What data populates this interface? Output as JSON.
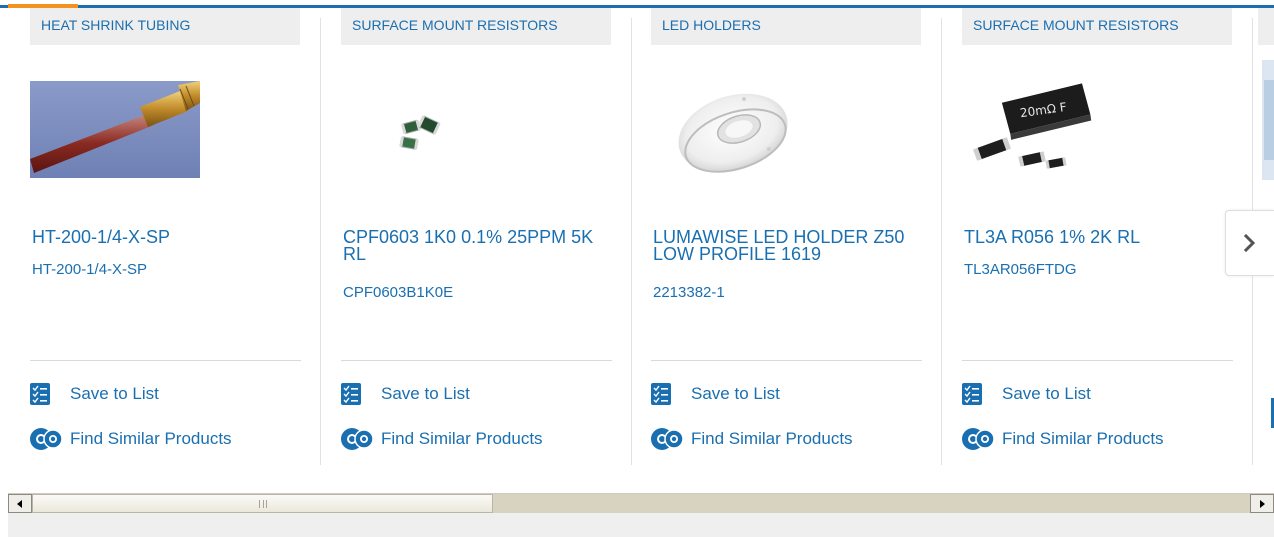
{
  "products": [
    {
      "category": "HEAT SHRINK TUBING",
      "title": "HT-200-1/4-X-SP",
      "part_number": "HT-200-1/4-X-SP",
      "image": "heat-shrink-tubing-photo",
      "save_label": "Save to List",
      "similar_label": "Find Similar Products"
    },
    {
      "category": "SURFACE MOUNT RESISTORS",
      "title": "CPF0603 1K0 0.1% 25PPM 5K RL",
      "part_number": "CPF0603B1K0E",
      "image": "smd-resistor-chips-photo",
      "save_label": "Save to List",
      "similar_label": "Find Similar Products"
    },
    {
      "category": "LED HOLDERS",
      "title": "LUMAWISE LED HOLDER Z50 LOW PROFILE 1619",
      "part_number": "2213382-1",
      "image": "led-holder-ring-photo",
      "save_label": "Save to List",
      "similar_label": "Find Similar Products"
    },
    {
      "category": "SURFACE MOUNT RESISTORS",
      "title": "TL3A R056 1% 2K RL",
      "part_number": "TL3AR056FTDG",
      "image": "current-sense-resistor-photo",
      "image_text": "20mΩ F",
      "save_label": "Save to List",
      "similar_label": "Find Similar Products"
    }
  ],
  "carousel": {
    "next_icon": "chevron-right-icon"
  },
  "scrollbar": {
    "position_fraction": 0.02,
    "visible_fraction": 0.37
  },
  "colors": {
    "link_blue": "#1a6fb0",
    "accent_orange": "#f39221",
    "category_bg": "#eeeeee"
  }
}
